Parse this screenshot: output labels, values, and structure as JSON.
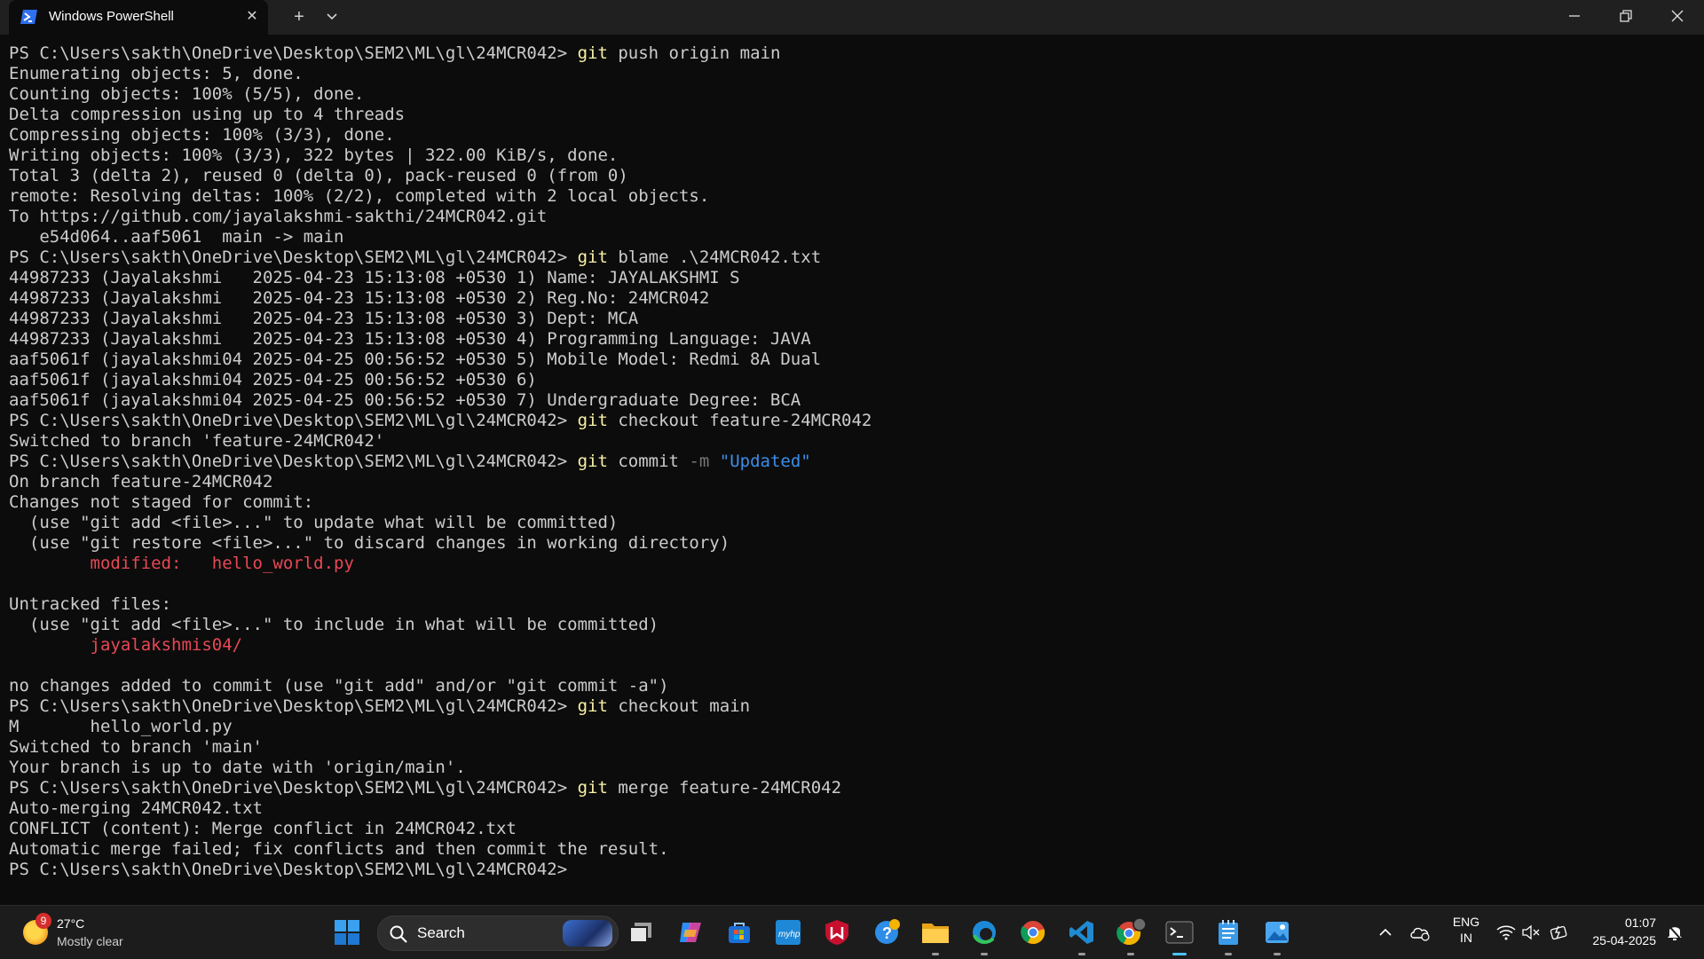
{
  "window": {
    "tab_title": "Windows PowerShell",
    "new_tab_symbol": "+",
    "dropdown_symbol": "⌄",
    "close_tab_symbol": "✕"
  },
  "terminal": {
    "lines": [
      [
        {
          "t": "PS C:\\Users\\sakth\\OneDrive\\Desktop\\SEM2\\ML\\gl\\24MCR042> ",
          "c": ""
        },
        {
          "t": "git",
          "c": "cmd"
        },
        {
          "t": " push origin main",
          "c": "arg"
        }
      ],
      [
        {
          "t": "Enumerating objects: 5, done.",
          "c": ""
        }
      ],
      [
        {
          "t": "Counting objects: 100% (5/5), done.",
          "c": ""
        }
      ],
      [
        {
          "t": "Delta compression using up to 4 threads",
          "c": ""
        }
      ],
      [
        {
          "t": "Compressing objects: 100% (3/3), done.",
          "c": ""
        }
      ],
      [
        {
          "t": "Writing objects: 100% (3/3), 322 bytes | 322.00 KiB/s, done.",
          "c": ""
        }
      ],
      [
        {
          "t": "Total 3 (delta 2), reused 0 (delta 0), pack-reused 0 (from 0)",
          "c": ""
        }
      ],
      [
        {
          "t": "remote: Resolving deltas: 100% (2/2), completed with 2 local objects.",
          "c": ""
        }
      ],
      [
        {
          "t": "To https://github.com/jayalakshmi-sakthi/24MCR042.git",
          "c": ""
        }
      ],
      [
        {
          "t": "   e54d064..aaf5061  main -> main",
          "c": ""
        }
      ],
      [
        {
          "t": "PS C:\\Users\\sakth\\OneDrive\\Desktop\\SEM2\\ML\\gl\\24MCR042> ",
          "c": ""
        },
        {
          "t": "git",
          "c": "cmd"
        },
        {
          "t": " blame .\\24MCR042.txt",
          "c": "arg"
        }
      ],
      [
        {
          "t": "44987233 (Jayalakshmi   2025-04-23 15:13:08 +0530 1) Name: JAYALAKSHMI S",
          "c": ""
        }
      ],
      [
        {
          "t": "44987233 (Jayalakshmi   2025-04-23 15:13:08 +0530 2) Reg.No: 24MCR042",
          "c": ""
        }
      ],
      [
        {
          "t": "44987233 (Jayalakshmi   2025-04-23 15:13:08 +0530 3) Dept: MCA",
          "c": ""
        }
      ],
      [
        {
          "t": "44987233 (Jayalakshmi   2025-04-23 15:13:08 +0530 4) Programming Language: JAVA",
          "c": ""
        }
      ],
      [
        {
          "t": "aaf5061f (jayalakshmi04 2025-04-25 00:56:52 +0530 5) Mobile Model: Redmi 8A Dual",
          "c": ""
        }
      ],
      [
        {
          "t": "aaf5061f (jayalakshmi04 2025-04-25 00:56:52 +0530 6)",
          "c": ""
        }
      ],
      [
        {
          "t": "aaf5061f (jayalakshmi04 2025-04-25 00:56:52 +0530 7) Undergraduate Degree: BCA",
          "c": ""
        }
      ],
      [
        {
          "t": "PS C:\\Users\\sakth\\OneDrive\\Desktop\\SEM2\\ML\\gl\\24MCR042> ",
          "c": ""
        },
        {
          "t": "git",
          "c": "cmd"
        },
        {
          "t": " checkout feature-24MCR042",
          "c": "arg"
        }
      ],
      [
        {
          "t": "Switched to branch 'feature-24MCR042'",
          "c": ""
        }
      ],
      [
        {
          "t": "PS C:\\Users\\sakth\\OneDrive\\Desktop\\SEM2\\ML\\gl\\24MCR042> ",
          "c": ""
        },
        {
          "t": "git",
          "c": "cmd"
        },
        {
          "t": " commit ",
          "c": "arg"
        },
        {
          "t": "-m",
          "c": "flag"
        },
        {
          "t": " ",
          "c": "arg"
        },
        {
          "t": "\"Updated\"",
          "c": "str"
        }
      ],
      [
        {
          "t": "On branch feature-24MCR042",
          "c": ""
        }
      ],
      [
        {
          "t": "Changes not staged for commit:",
          "c": ""
        }
      ],
      [
        {
          "t": "  (use \"git add <file>...\" to update what will be committed)",
          "c": ""
        }
      ],
      [
        {
          "t": "  (use \"git restore <file>...\" to discard changes in working directory)",
          "c": ""
        }
      ],
      [
        {
          "t": "        ",
          "c": ""
        },
        {
          "t": "modified:   hello_world.py",
          "c": "red"
        }
      ],
      [
        {
          "t": "",
          "c": ""
        }
      ],
      [
        {
          "t": "Untracked files:",
          "c": ""
        }
      ],
      [
        {
          "t": "  (use \"git add <file>...\" to include in what will be committed)",
          "c": ""
        }
      ],
      [
        {
          "t": "        ",
          "c": ""
        },
        {
          "t": "jayalakshmis04/",
          "c": "red"
        }
      ],
      [
        {
          "t": "",
          "c": ""
        }
      ],
      [
        {
          "t": "no changes added to commit (use \"git add\" and/or \"git commit -a\")",
          "c": ""
        }
      ],
      [
        {
          "t": "PS C:\\Users\\sakth\\OneDrive\\Desktop\\SEM2\\ML\\gl\\24MCR042> ",
          "c": ""
        },
        {
          "t": "git",
          "c": "cmd"
        },
        {
          "t": " checkout main",
          "c": "arg"
        }
      ],
      [
        {
          "t": "M       hello_world.py",
          "c": ""
        }
      ],
      [
        {
          "t": "Switched to branch 'main'",
          "c": ""
        }
      ],
      [
        {
          "t": "Your branch is up to date with 'origin/main'.",
          "c": ""
        }
      ],
      [
        {
          "t": "PS C:\\Users\\sakth\\OneDrive\\Desktop\\SEM2\\ML\\gl\\24MCR042> ",
          "c": ""
        },
        {
          "t": "git",
          "c": "cmd"
        },
        {
          "t": " merge feature-24MCR042",
          "c": "arg"
        }
      ],
      [
        {
          "t": "Auto-merging 24MCR042.txt",
          "c": ""
        }
      ],
      [
        {
          "t": "CONFLICT (content): Merge conflict in 24MCR042.txt",
          "c": ""
        }
      ],
      [
        {
          "t": "Automatic merge failed; fix conflicts and then commit the result.",
          "c": ""
        }
      ],
      [
        {
          "t": "PS C:\\Users\\sakth\\OneDrive\\Desktop\\SEM2\\ML\\gl\\24MCR042> ",
          "c": ""
        }
      ]
    ]
  },
  "taskbar": {
    "weather": {
      "badge": "9",
      "temp": "27°C",
      "condition": "Mostly clear"
    },
    "search_placeholder": "Search",
    "apps": [
      "start-icon",
      "task-view-icon",
      "copilot-icon",
      "store-icon",
      "myhp-icon",
      "mcafee-icon",
      "help-icon",
      "file-explorer-icon",
      "edge-icon",
      "chrome-icon",
      "vscode-icon",
      "chrome-profile-icon",
      "terminal-icon",
      "notepad-icon",
      "photos-icon"
    ],
    "language": {
      "line1": "ENG",
      "line2": "IN"
    },
    "clock": {
      "time": "01:07",
      "date": "25-04-2025"
    }
  },
  "colors": {
    "command": "#f9f1a5",
    "flag": "#767676",
    "string": "#3b8eea",
    "git_status_red": "#e74856",
    "terminal_bg": "#0c0c0c"
  }
}
